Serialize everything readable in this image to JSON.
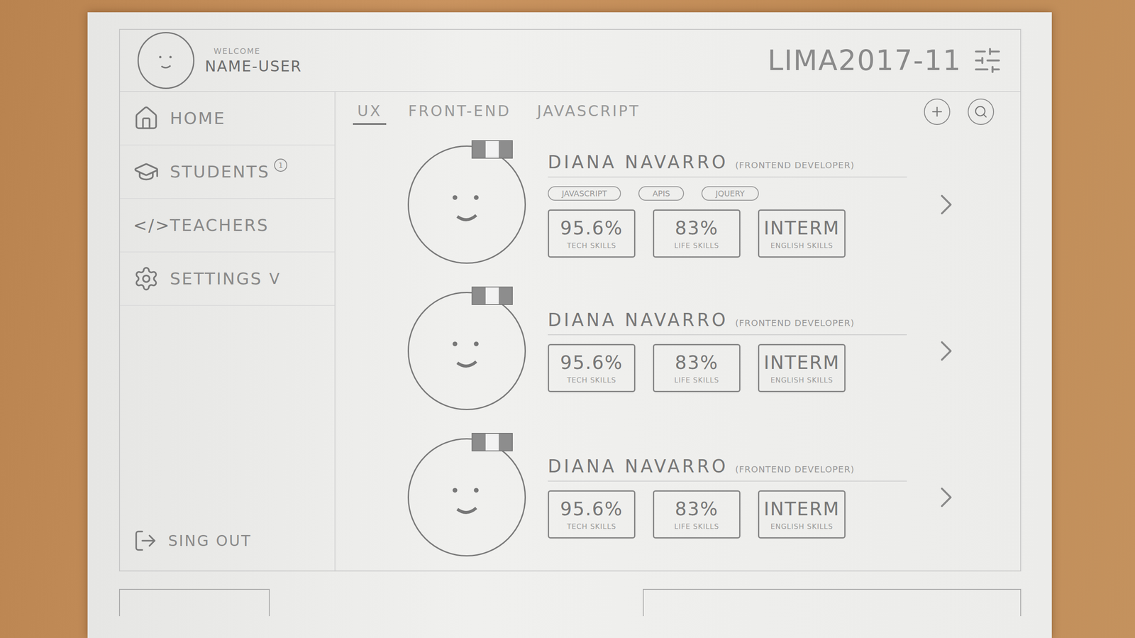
{
  "header": {
    "greeting": "WELCOME",
    "user": "NAME-USER",
    "cohort": "LIMA2017-11"
  },
  "sidebar": {
    "items": [
      {
        "label": "HOME"
      },
      {
        "label": "STUDENTS",
        "badge": "1"
      },
      {
        "label": "TEACHERS",
        "glyph": "</>"
      },
      {
        "label": "SETTINGS",
        "caret": "V"
      }
    ],
    "sign_out": "SING OUT"
  },
  "tabs": [
    {
      "label": "UX",
      "selected": true
    },
    {
      "label": "FRONT-END",
      "selected": false
    },
    {
      "label": "JAVASCRIPT",
      "selected": false
    }
  ],
  "students": [
    {
      "name": "DIANA NAVARRO",
      "role": "(FRONTEND DEVELOPER)",
      "tags": [
        "JAVASCRIPT",
        "APIS",
        "JQUERY"
      ],
      "stats": [
        {
          "value": "95.6%",
          "label": "TECH SKILLS"
        },
        {
          "value": "83%",
          "label": "LIFE SKILLS"
        },
        {
          "value": "INTERM",
          "label": "ENGLISH SKILLS"
        }
      ]
    },
    {
      "name": "DIANA NAVARRO",
      "role": "(FRONTEND DEVELOPER)",
      "tags": [],
      "stats": [
        {
          "value": "95.6%",
          "label": "TECH SKILLS"
        },
        {
          "value": "83%",
          "label": "LIFE SKILLS"
        },
        {
          "value": "INTERM",
          "label": "ENGLISH SKILLS"
        }
      ]
    },
    {
      "name": "DIANA NAVARRO",
      "role": "(FRONTEND DEVELOPER)",
      "tags": [],
      "stats": [
        {
          "value": "95.6%",
          "label": "TECH SKILLS"
        },
        {
          "value": "83%",
          "label": "LIFE SKILLS"
        },
        {
          "value": "INTERM",
          "label": "ENGLISH SKILLS"
        }
      ]
    }
  ]
}
